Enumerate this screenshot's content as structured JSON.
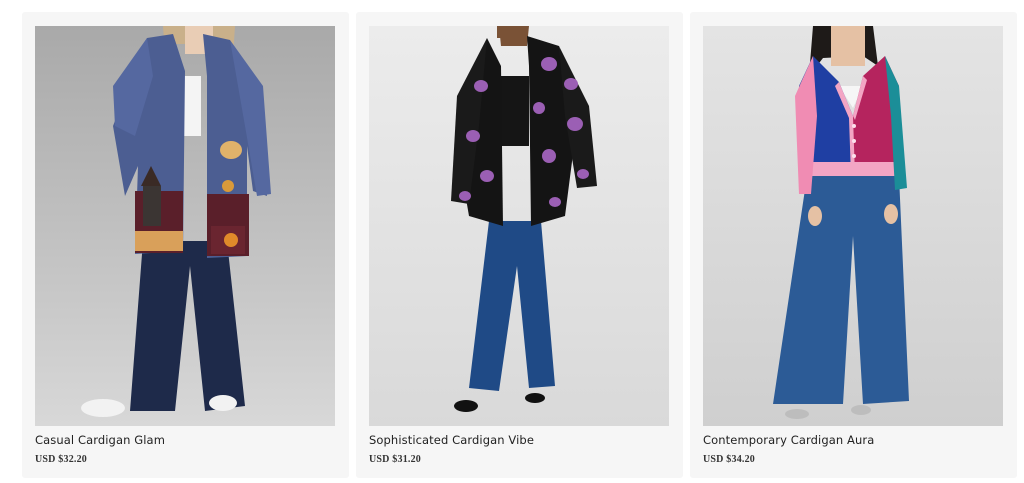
{
  "products": [
    {
      "title": "Casual Cardigan Glam",
      "price": "USD $32.20",
      "image": "woman-in-blue-halloween-cardigan-photo"
    },
    {
      "title": "Sophisticated Cardigan Vibe",
      "price": "USD $31.20",
      "image": "woman-in-black-purple-pattern-cardigan-photo"
    },
    {
      "title": "Contemporary Cardigan Aura",
      "price": "USD $34.20",
      "image": "woman-in-colorblock-cardigan-photo"
    }
  ],
  "colors": {
    "card_background": "#f6f6f6",
    "text": "#222222"
  }
}
